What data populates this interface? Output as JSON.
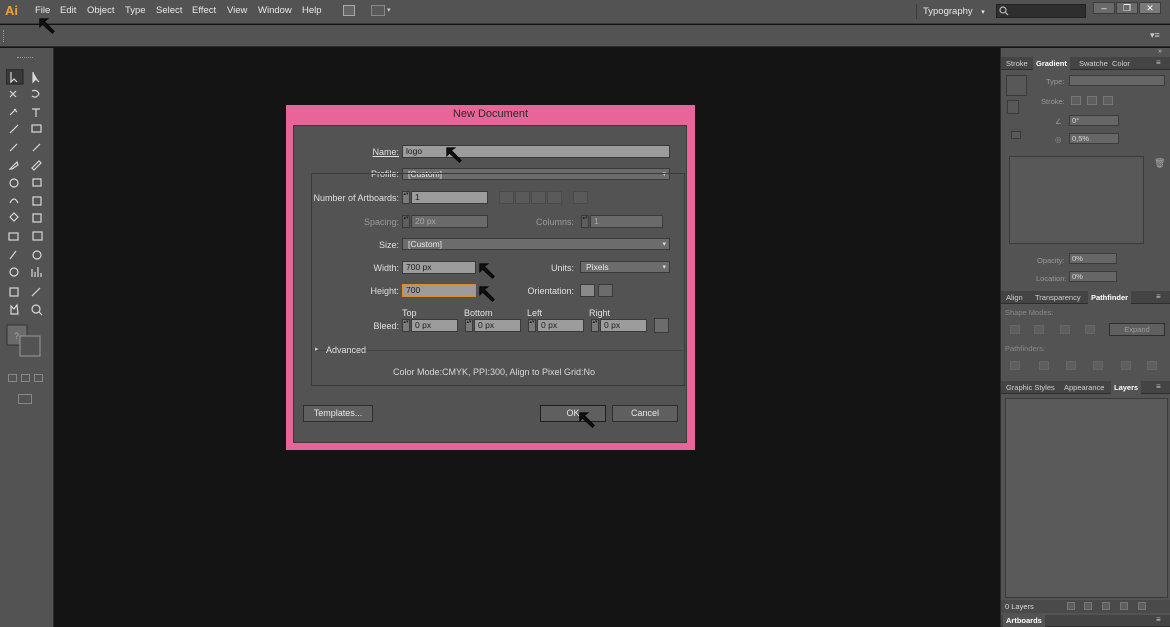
{
  "app": {
    "logo": "Ai"
  },
  "menu": [
    "File",
    "Edit",
    "Object",
    "Type",
    "Select",
    "Effect",
    "View",
    "Window",
    "Help"
  ],
  "workspace": {
    "label": "Typography",
    "caret": "▾"
  },
  "window_controls": {
    "minimize": "–",
    "restore": "❐",
    "close": "✕"
  },
  "panels": {
    "top_tabs": [
      "Stroke",
      "Gradient",
      "Swatche",
      "Color"
    ],
    "gradient": {
      "type_label": "Type:",
      "stroke_label": "Stroke:",
      "angle_value": "0°",
      "aspect_value": "0,5%",
      "opacity_label": "Opacity:",
      "opacity_value": "0%",
      "location_label": "Location:",
      "location_value": "0%"
    },
    "mid_tabs": [
      "Align",
      "Transparency",
      "Pathfinder"
    ],
    "pathfinder": {
      "shape_modes_label": "Shape Modes:",
      "expand_label": "Expand",
      "pathfinders_label": "Pathfinders:"
    },
    "bottom_tabs": [
      "Graphic Styles",
      "Appearance",
      "Layers"
    ],
    "layers_count": "0 Layers",
    "artboards_tab": "Artboards"
  },
  "dialog": {
    "title": "New Document",
    "name_label": "Name:",
    "name_value": "logo",
    "profile_label": "Profile:",
    "profile_value": "[Custom]",
    "artboards_label": "Number of Artboards:",
    "artboards_value": "1",
    "spacing_label": "Spacing:",
    "spacing_value": "20 px",
    "columns_label": "Columns:",
    "columns_value": "1",
    "size_label": "Size:",
    "size_value": "[Custom]",
    "width_label": "Width:",
    "width_value": "700 px",
    "units_label": "Units:",
    "units_value": "Pixels",
    "height_label": "Height:",
    "height_value": "700",
    "orientation_label": "Orientation:",
    "bleed_label": "Bleed:",
    "bleed_top_label": "Top",
    "bleed_bottom_label": "Bottom",
    "bleed_left_label": "Left",
    "bleed_right_label": "Right",
    "bleed_top": "0 px",
    "bleed_bottom": "0 px",
    "bleed_left": "0 px",
    "bleed_right": "0 px",
    "advanced_label": "Advanced",
    "advanced_caret": "▸",
    "color_info": "Color Mode:CMYK, PPI:300, Align to Pixel Grid:No",
    "templates_button": "Templates...",
    "ok_button": "OK",
    "cancel_button": "Cancel",
    "select_caret": "▾",
    "spin_glyph": "▴▾"
  },
  "colors": {
    "dialog_frame": "#e8659a",
    "ui_gray": "#535353",
    "canvas": "#141414",
    "logo": "#f0a030"
  }
}
